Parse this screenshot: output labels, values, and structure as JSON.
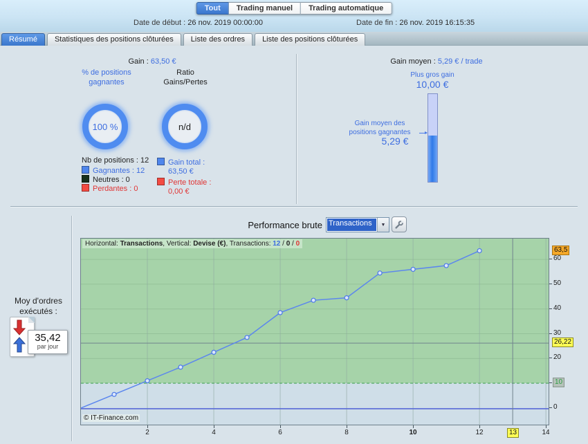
{
  "topbar": {
    "tabs": [
      {
        "label": "Tout",
        "active": true
      },
      {
        "label": "Trading manuel",
        "active": false
      },
      {
        "label": "Trading automatique",
        "active": false
      }
    ]
  },
  "dates": {
    "start_label": "Date de début :",
    "start_value": "26 nov. 2019 00:00:00",
    "end_label": "Date de fin :",
    "end_value": "26 nov. 2019 16:15:35"
  },
  "nav_tabs": [
    {
      "label": "Résumé",
      "active": true
    },
    {
      "label": "Statistiques des positions clôturées",
      "active": false
    },
    {
      "label": "Liste des ordres",
      "active": false
    },
    {
      "label": "Liste des positions clôturées",
      "active": false
    }
  ],
  "summary": {
    "gain_label": "Gain :",
    "gain_value": "63,50 €",
    "winning_pct": {
      "label": "% de positions gagnantes",
      "value": "100 %"
    },
    "ratio": {
      "label": "Ratio Gains/Pertes",
      "value": "n/d"
    },
    "positions_label": "Nb de positions : 12",
    "winning": "Gagnantes : 12",
    "neutral": "Neutres : 0",
    "losing": "Perdantes : 0",
    "gain_total_label": "Gain total :",
    "gain_total_value": "63,50 €",
    "loss_total_label": "Perte totale :",
    "loss_total_value": "0,00 €"
  },
  "gain_moyen": {
    "label": "Gain moyen :",
    "value": "5,29 € / trade",
    "biggest_gain_label": "Plus gros gain",
    "biggest_gain_value": "10,00 €",
    "avg_win_label": "Gain moyen des positions gagnantes",
    "avg_win_value": "5,29 €"
  },
  "orders_per_day": {
    "label": "Moy d'ordres exécutés :",
    "value": "35,42",
    "unit": "par jour"
  },
  "performance": {
    "label": "Performance brute",
    "selector_value": "Transactions",
    "tool_icon": "wrench-icon"
  },
  "chart_data": {
    "type": "line",
    "title": "Performance brute (Transactions)",
    "header": {
      "h1": "Horizontal: ",
      "h2": "Transactions",
      "h3": ", Vertical: ",
      "h4": "Devise (€)",
      "h5": ", Transactions: ",
      "count_win": "12",
      "separator": " / ",
      "count_neutral": "0",
      "count_loss": "0"
    },
    "copyright": "© IT-Finance.com",
    "series": [
      {
        "name": "performance-cumulee",
        "x": [
          0,
          1,
          2,
          3,
          4,
          5,
          6,
          7,
          8,
          9,
          10,
          11,
          12
        ],
        "y": [
          0,
          5.5,
          11,
          16.5,
          22.5,
          28.5,
          38.5,
          43.5,
          44.5,
          54.5,
          56,
          57.5,
          63.5
        ]
      }
    ],
    "xlim": [
      0,
      14.08
    ],
    "ylim": [
      -6.7,
      68.4
    ],
    "x_ticks": [
      2,
      4,
      6,
      8,
      10,
      12,
      14
    ],
    "emphasized_x_tick": 10,
    "y_ticks": [
      0,
      10,
      20,
      30,
      40,
      50,
      60
    ],
    "threshold_value": 10,
    "zero_line": 0,
    "cursor": {
      "x": 13,
      "x_label": "13",
      "y": 26.22,
      "y_label": "26,22"
    },
    "last_value": {
      "value": 63.5,
      "label": "63,5"
    },
    "grid": true,
    "legend_position": "none",
    "colors": {
      "line": "#5b86ee",
      "marker_fill": "#dbe6fb",
      "marker_stroke": "#4a78e8",
      "green_zone": "#a6d3a9",
      "blue_zone": "#cfdee8",
      "grid_h": "#93c097",
      "grid_v": "#8fa8a2",
      "threshold": "#3fa050",
      "zero": "#5c6ed8",
      "cursor": "#70838d"
    }
  }
}
